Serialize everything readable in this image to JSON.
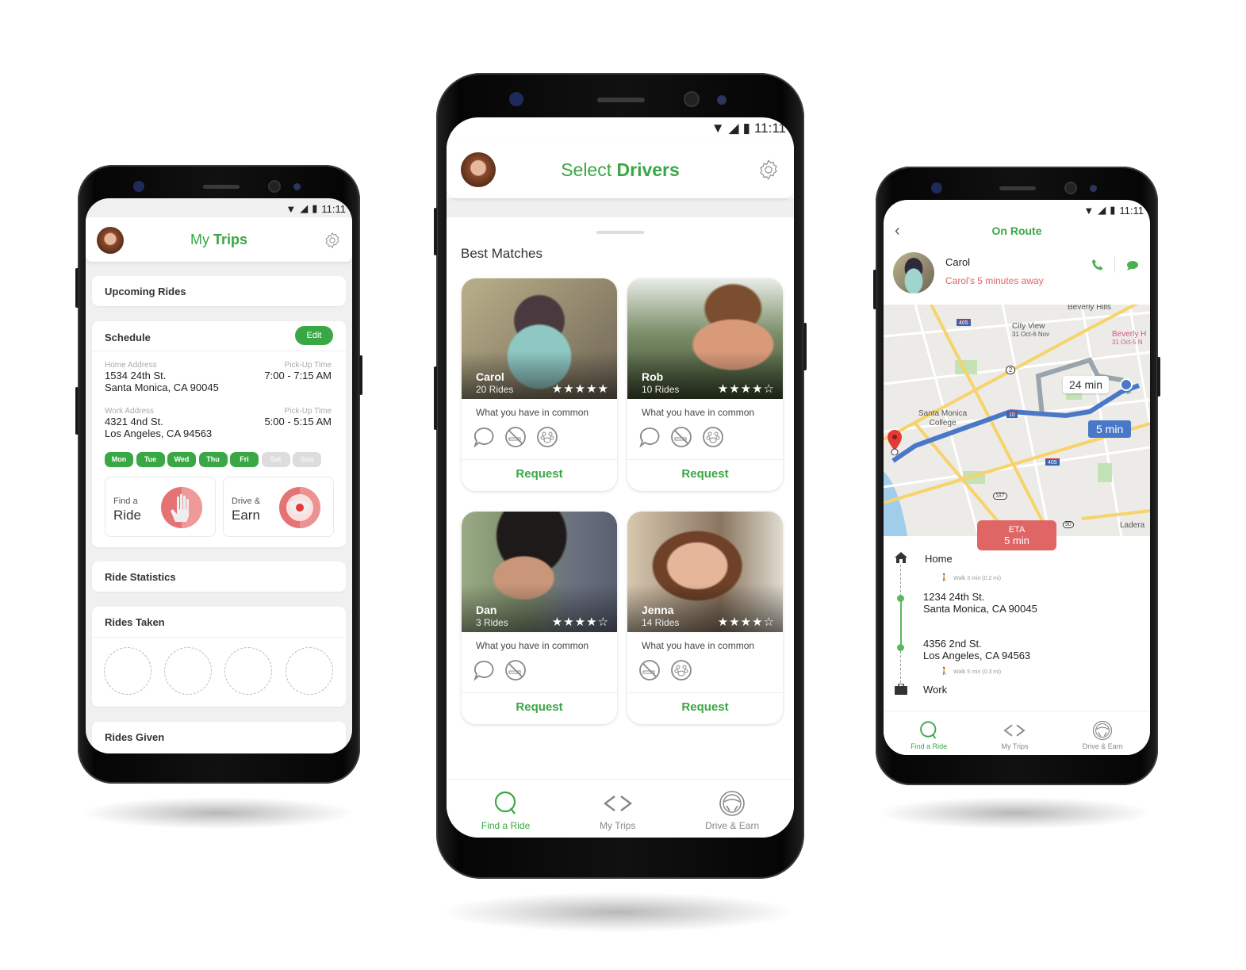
{
  "status_bar": {
    "time": "11:11",
    "icons": [
      "wifi-icon",
      "signal-icon",
      "battery-icon"
    ]
  },
  "left_phone": {
    "title_light": "My",
    "title_bold": "Trips",
    "sections": {
      "upcoming": "Upcoming Rides",
      "schedule": "Schedule",
      "edit_label": "Edit",
      "ride_statistics": "Ride Statistics",
      "rides_taken": "Rides Taken",
      "rides_given": "Rides Given"
    },
    "schedule": {
      "home": {
        "label": "Home Address",
        "line1": "1534 24th St.",
        "line2": "Santa Monica, CA 90045",
        "time_label": "Pick-Up Time",
        "time": "7:00 - 7:15 AM"
      },
      "work": {
        "label": "Work Address",
        "line1": "4321 4nd St.",
        "line2": "Los Angeles, CA  94563",
        "time_label": "Pick-Up Time",
        "time": "5:00 - 5:15 AM"
      },
      "days": [
        {
          "label": "Mon",
          "active": true
        },
        {
          "label": "Tue",
          "active": true
        },
        {
          "label": "Wed",
          "active": true
        },
        {
          "label": "Thu",
          "active": true
        },
        {
          "label": "Fri",
          "active": true
        },
        {
          "label": "Sat",
          "active": false
        },
        {
          "label": "Sun",
          "active": false
        }
      ]
    },
    "actions": [
      {
        "small": "Find a",
        "big": "Ride",
        "icon": "hand-icon"
      },
      {
        "small": "Drive &",
        "big": "Earn",
        "icon": "steering-wheel-icon"
      }
    ]
  },
  "center_phone": {
    "title_light": "Select",
    "title_bold": "Drivers",
    "section_title": "Best Matches",
    "common_label": "What you have in common",
    "request_label": "Request",
    "drivers": [
      {
        "name": "Carol",
        "rides": "20 Rides",
        "rating": 5,
        "common": [
          "chat",
          "no-smoking",
          "no-pets"
        ]
      },
      {
        "name": "Rob",
        "rides": "10 Rides",
        "rating": 4,
        "common": [
          "chat",
          "no-smoking",
          "no-pets"
        ]
      },
      {
        "name": "Dan",
        "rides": "3 Rides",
        "rating": 4,
        "common": [
          "chat",
          "no-smoking"
        ]
      },
      {
        "name": "Jenna",
        "rides": "14 Rides",
        "rating": 4,
        "common": [
          "no-smoking",
          "no-pets"
        ]
      }
    ],
    "nav": [
      {
        "label": "Find a Ride",
        "icon": "search-icon",
        "active": true
      },
      {
        "label": "My Trips",
        "icon": "trips-icon",
        "active": false
      },
      {
        "label": "Drive & Earn",
        "icon": "steering-wheel-icon",
        "active": false
      }
    ]
  },
  "right_phone": {
    "title": "On Route",
    "driver_name": "Carol",
    "driver_status": "Carol's 5 minutes away",
    "map": {
      "labels": {
        "beverly_hills": "Beverly Hills",
        "city_view": "City View",
        "city_view_dates": "31 Oct-6 Nov",
        "beverly_h": "Beverly H",
        "beverly_h_dates": "31 Oct-5 N",
        "santa_monica": "Santa Monica",
        "college": "College",
        "ladera": "Ladera",
        "hwy_405": "405",
        "hwy_10": "10",
        "hwy_2": "2",
        "hwy_187": "187",
        "hwy_90": "90"
      },
      "alt_route_time": "24 min",
      "route_time": "5 min"
    },
    "eta_label": "ETA",
    "eta_value": "5 min",
    "timeline": {
      "home": "Home",
      "walk1": "Walk 3 min (0.2 mi)",
      "stop1_line1": "1234 24th St.",
      "stop1_line2": "Santa Monica, CA 90045",
      "stop2_line1": "4356 2nd St.",
      "stop2_line2": "Los Angeles, CA 94563",
      "walk2": "Walk 5 min (0.3 mi)",
      "work": "Work"
    },
    "nav": [
      {
        "label": "Find a Ride",
        "active": true
      },
      {
        "label": "My Trips",
        "active": false
      },
      {
        "label": "Drive & Earn",
        "active": false
      }
    ]
  },
  "colors": {
    "brand_green": "#3aa745",
    "alert_red": "#e06666",
    "route_blue": "#4a78c8"
  }
}
